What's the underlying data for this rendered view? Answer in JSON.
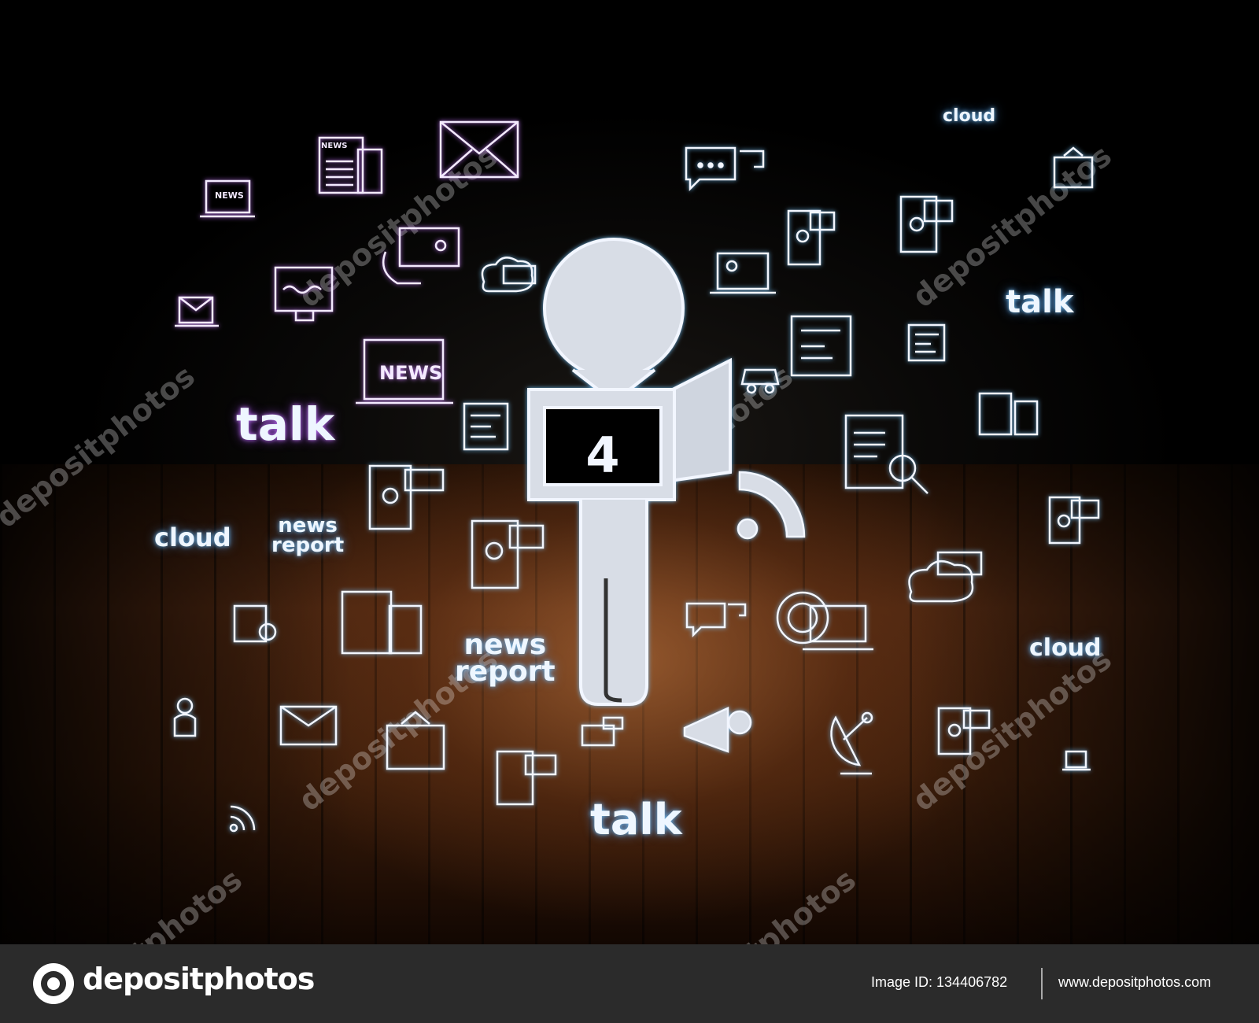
{
  "scene": {
    "center_icon": {
      "name": "microphone-icon",
      "flag_number": "4"
    },
    "words": {
      "talk_left": "talk",
      "talk_right": "talk",
      "talk_bottom": "talk",
      "cloud_top": "cloud",
      "cloud_left": "cloud",
      "cloud_right": "cloud",
      "news_report_left": "news\nreport",
      "news_report_center": "news\nreport"
    },
    "icon_labels": {
      "news": "NEWS"
    },
    "colors": {
      "glow_blue": "#78c8ff",
      "glow_violet": "#c878ff",
      "icon_stroke": "#f2f6ff"
    }
  },
  "watermark": {
    "text": "depositphotos"
  },
  "footer": {
    "logo_text": "depositphotos",
    "image_id": "Image ID: 134406782",
    "url": "www.depositphotos.com"
  }
}
